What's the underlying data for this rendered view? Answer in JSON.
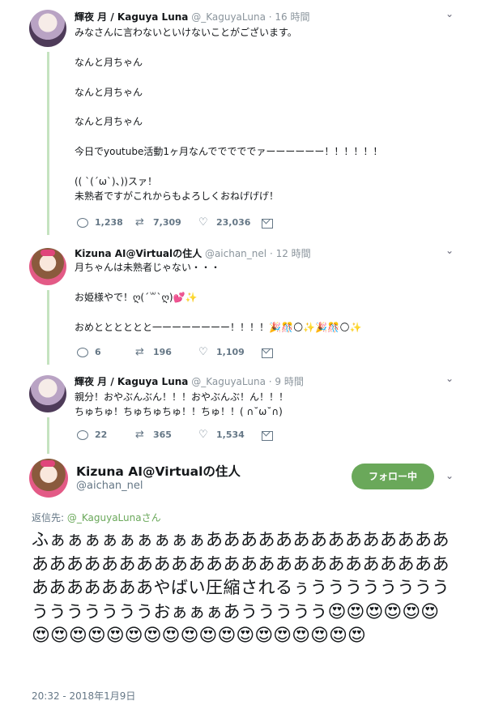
{
  "tweets": [
    {
      "name": "輝夜 月 / Kaguya Luna",
      "handle": "@_KaguyaLuna",
      "time": "· 16 時間",
      "lines": "みなさんに言わないといけないことがございます。\n\nなんと月ちゃん\n\nなんと月ちゃん\n\nなんと月ちゃん\n\n今日でyoutube活動1ヶ月なんでででででァーーーーーー！！！！！！\n\n(( ˋ(´ω`)、))スァ！\n未熟者ですがこれからもよろしくおねげげげ！",
      "replies": "1,238",
      "retweets": "7,309",
      "likes": "23,036"
    },
    {
      "name": "Kizuna AI@Virtualの住人",
      "handle": "@aichan_nel",
      "time": "· 12 時間",
      "lines": "月ちゃんは未熟者じゃない・・・\n\nお姫様やで！ღ(´꒳`ღ)💕✨\n\nおめとととととと一ーーーーーーー！！！！🎉🎊🌕✨🎉🎊🌕✨",
      "replies": "6",
      "retweets": "196",
      "likes": "1,109"
    },
    {
      "name": "輝夜 月 / Kaguya Luna",
      "handle": "@_KaguyaLuna",
      "time": "· 9 時間",
      "lines": "親分！おやぶんぶん！！！おやぶんぶ！ん！！！\nちゅちゅ！ちゅちゅちゅ！！ちゅ！！( ∩˘ω˘∩)",
      "replies": "22",
      "retweets": "365",
      "likes": "1,534"
    }
  ],
  "main": {
    "name": "Kizuna AI@Virtualの住人",
    "handle": "@aichan_nel",
    "follow_label": "フォロー中",
    "reply_prefix": "返信先: ",
    "reply_target": "@_KaguyaLunaさん",
    "text": "ふぁぁぁぁぁぁぁぁぁあああああああああああああああああああああああああああああああああああああああああああああやばい圧縮されるぅうううううううううううううううおぁぁぁあううううう",
    "emojis": "😍😍😍😍😍😍😍😍😍😍😍😍😍😍😍😍😍😍😍😍😍😍😍😍",
    "timestamp": "20:32 - 2018年1月9日"
  },
  "icons": {
    "reply": "reply-bubble-icon",
    "retweet": "retweet-icon",
    "like": "heart-icon",
    "dm": "envelope-icon",
    "caret": "chevron-down-icon"
  }
}
